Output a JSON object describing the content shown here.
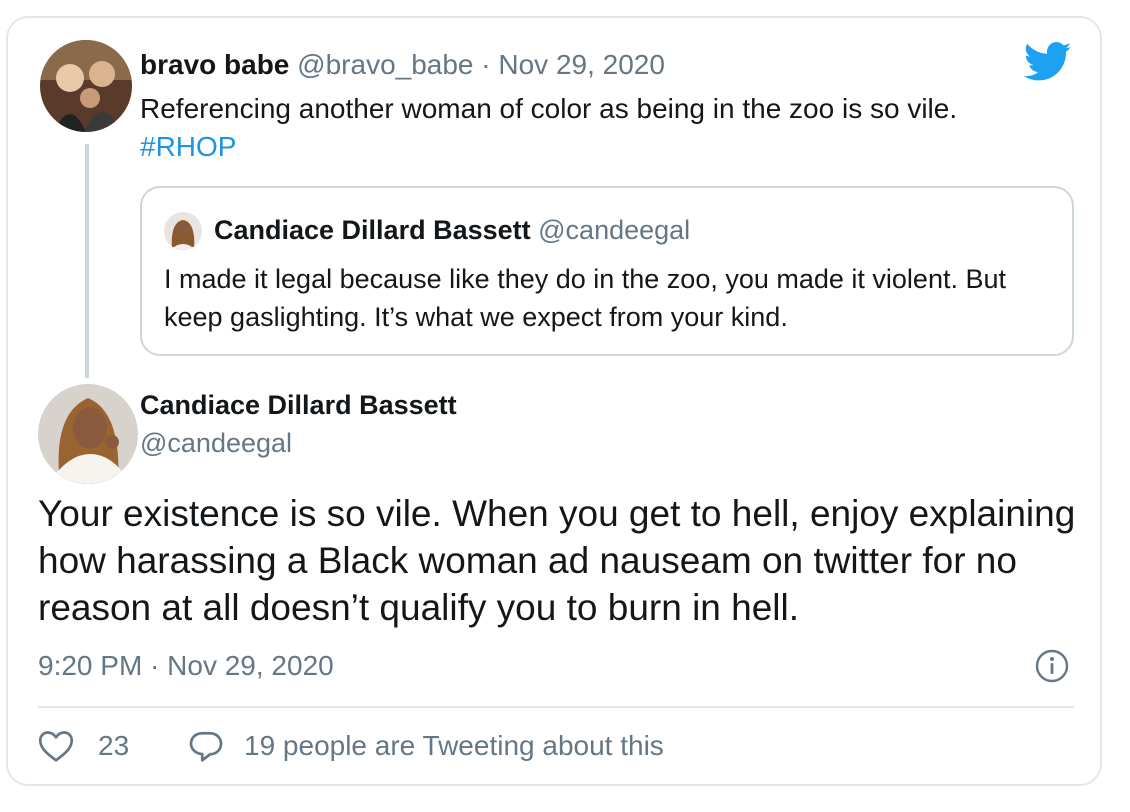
{
  "parent_tweet": {
    "display_name": "bravo babe",
    "handle": "@bravo_babe",
    "separator": "·",
    "date": "Nov 29, 2020",
    "text": "Referencing another woman of color as being in the zoo is so vile.",
    "hashtag": "#RHOP"
  },
  "quoted_tweet": {
    "display_name": "Candiace Dillard Bassett",
    "handle": "@candeegal",
    "text": "I made it legal because like they do in the zoo, you made it violent. But keep gaslighting. It’s what we expect from your kind."
  },
  "main_tweet": {
    "display_name": "Candiace Dillard Bassett",
    "handle": "@candeegal",
    "text": "Your existence is so vile. When you get to hell, enjoy explaining how harassing a Black woman ad nauseam on twitter for no reason at all doesn’t qualify you to burn in hell.",
    "timestamp": "9:20 PM · Nov 29, 2020",
    "like_count": "23",
    "reply_summary": "19 people are Tweeting about this"
  },
  "icons": {
    "brand": "twitter-bird-icon",
    "info": "info-icon",
    "like": "heart-icon",
    "reply": "speech-bubble-icon"
  },
  "colors": {
    "brand_blue": "#1da1f2",
    "hashtag_blue": "#1b95e0",
    "text": "#14171a",
    "muted": "#657786",
    "border": "#e1e8ed"
  }
}
